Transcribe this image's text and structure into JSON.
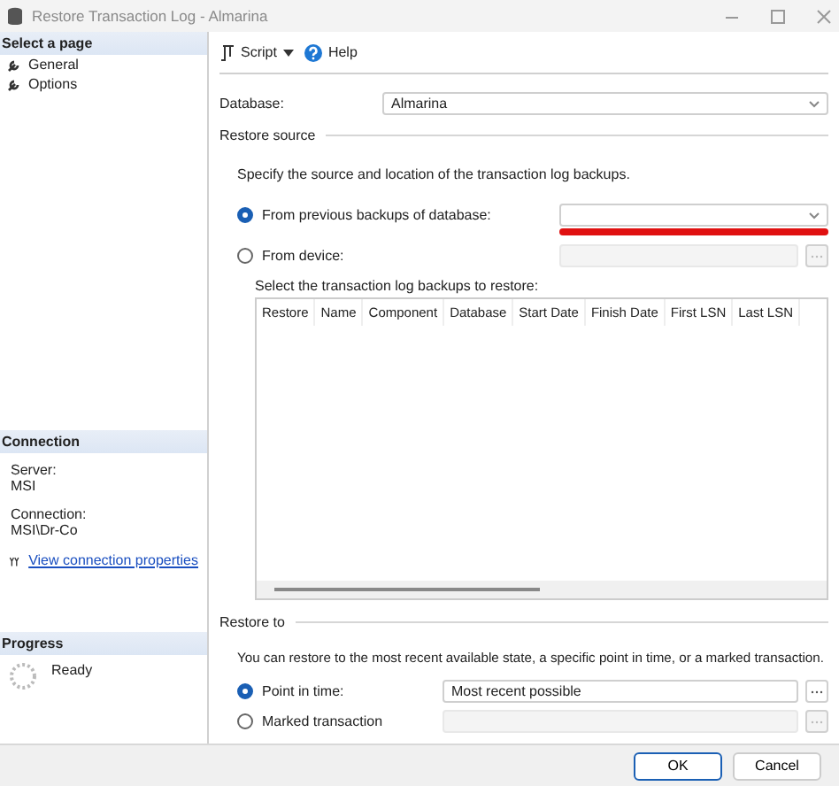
{
  "window": {
    "title": "Restore Transaction Log  -  Almarina"
  },
  "sidebar": {
    "header": "Select a page",
    "items": [
      {
        "label": "General",
        "selected": false
      },
      {
        "label": "Options",
        "selected": false
      }
    ]
  },
  "connection": {
    "header": "Connection",
    "server_label": "Server:",
    "server": "MSI",
    "connection_label": "Connection:",
    "connection": "MSI\\Dr-Co",
    "link": "View connection properties"
  },
  "progress": {
    "header": "Progress",
    "status": "Ready"
  },
  "toolbar": {
    "script": "Script",
    "help": "Help"
  },
  "database": {
    "label": "Database:",
    "value": "Almarina"
  },
  "restore_source": {
    "title": "Restore source",
    "description": "Specify the source and location of the transaction log backups.",
    "options": [
      {
        "label": "From previous backups of database:",
        "selected": true,
        "kind": "dropdown",
        "disabled": false,
        "highlighted": true
      },
      {
        "label": "From device:",
        "selected": false,
        "kind": "browse",
        "disabled": true,
        "highlighted": false
      }
    ]
  },
  "backup_table": {
    "label": "Select the transaction log backups to restore:",
    "columns": [
      "Restore",
      "Name",
      "Component",
      "Database",
      "Start Date",
      "Finish Date",
      "First LSN",
      "Last LSN"
    ]
  },
  "restore_to": {
    "title": "Restore to",
    "description": "You can restore to the most recent available state, a specific point in time, or a marked transaction.",
    "options": [
      {
        "label": "Point in time:",
        "selected": true,
        "value": "Most recent possible",
        "disabled": false
      },
      {
        "label": "Marked transaction",
        "selected": false,
        "disabled": true
      }
    ]
  },
  "buttons": [
    {
      "label": "OK",
      "default": true
    },
    {
      "label": "Cancel",
      "default": false
    }
  ]
}
